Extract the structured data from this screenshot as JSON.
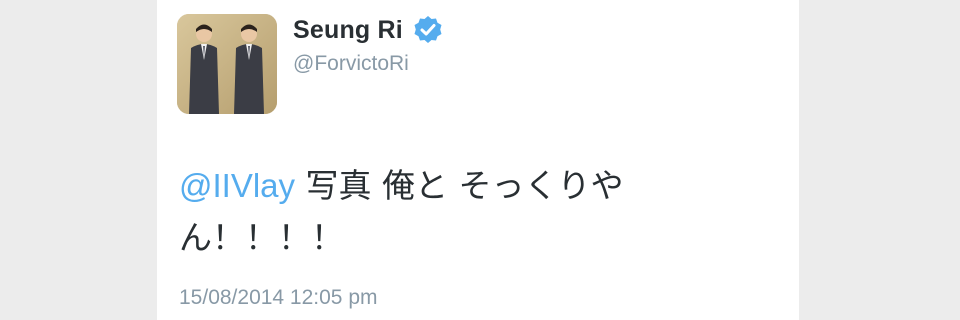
{
  "tweet": {
    "display_name": "Seung Ri",
    "handle": "@ForvictoRi",
    "verified": true,
    "mention": "@IIVlay",
    "text_after_mention": " 写真 俺と そっくりやん！！！！",
    "timestamp": "15/08/2014 12:05 pm"
  },
  "colors": {
    "link": "#55acee",
    "verified_badge": "#55acee",
    "text": "#292f33",
    "secondary_text": "#8899a6"
  },
  "icons": {
    "verified": "verified-badge-icon",
    "avatar": "profile-avatar-image"
  }
}
